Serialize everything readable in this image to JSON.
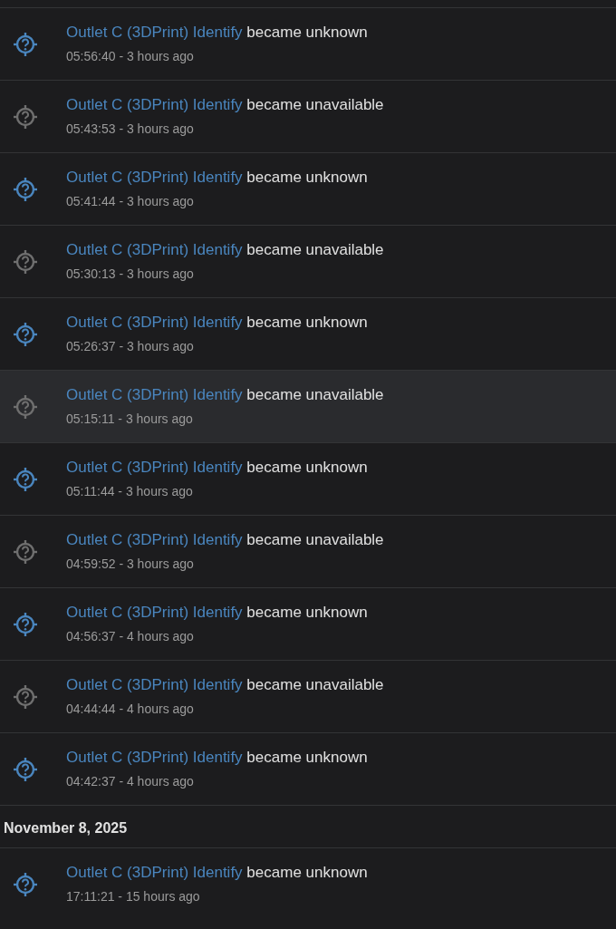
{
  "sections": [
    {
      "entries": [
        {
          "kind": "unknown",
          "entity": "Outlet C (3DPrint) Identify",
          "message": "became unknown",
          "time": "05:56:40 - 3 hours ago",
          "highlighted": false
        },
        {
          "kind": "unavailable",
          "entity": "Outlet C (3DPrint) Identify",
          "message": "became unavailable",
          "time": "05:43:53 - 3 hours ago",
          "highlighted": false
        },
        {
          "kind": "unknown",
          "entity": "Outlet C (3DPrint) Identify",
          "message": "became unknown",
          "time": "05:41:44 - 3 hours ago",
          "highlighted": false
        },
        {
          "kind": "unavailable",
          "entity": "Outlet C (3DPrint) Identify",
          "message": "became unavailable",
          "time": "05:30:13 - 3 hours ago",
          "highlighted": false
        },
        {
          "kind": "unknown",
          "entity": "Outlet C (3DPrint) Identify",
          "message": "became unknown",
          "time": "05:26:37 - 3 hours ago",
          "highlighted": false
        },
        {
          "kind": "unavailable",
          "entity": "Outlet C (3DPrint) Identify",
          "message": "became unavailable",
          "time": "05:15:11 - 3 hours ago",
          "highlighted": true
        },
        {
          "kind": "unknown",
          "entity": "Outlet C (3DPrint) Identify",
          "message": "became unknown",
          "time": "05:11:44 - 3 hours ago",
          "highlighted": false
        },
        {
          "kind": "unavailable",
          "entity": "Outlet C (3DPrint) Identify",
          "message": "became unavailable",
          "time": "04:59:52 - 3 hours ago",
          "highlighted": false
        },
        {
          "kind": "unknown",
          "entity": "Outlet C (3DPrint) Identify",
          "message": "became unknown",
          "time": "04:56:37 - 4 hours ago",
          "highlighted": false
        },
        {
          "kind": "unavailable",
          "entity": "Outlet C (3DPrint) Identify",
          "message": "became unavailable",
          "time": "04:44:44 - 4 hours ago",
          "highlighted": false
        },
        {
          "kind": "unknown",
          "entity": "Outlet C (3DPrint) Identify",
          "message": "became unknown",
          "time": "04:42:37 - 4 hours ago",
          "highlighted": false
        }
      ]
    },
    {
      "date": "November 8, 2025",
      "entries": [
        {
          "kind": "unknown",
          "entity": "Outlet C (3DPrint) Identify",
          "message": "became unknown",
          "time": "17:11:21 - 15 hours ago",
          "highlighted": false
        }
      ]
    }
  ]
}
